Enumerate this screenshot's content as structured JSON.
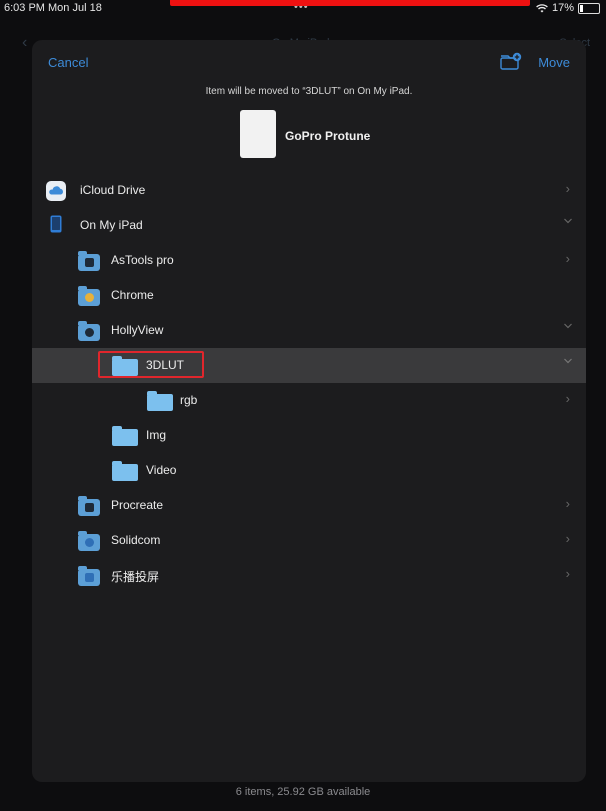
{
  "status_bar": {
    "time_date": "6:03 PM  Mon Jul 18",
    "dots": "•••",
    "battery_text": "17%"
  },
  "background": {
    "back_glyph": "‹",
    "title": "On My iPad",
    "select": "Select"
  },
  "sheet": {
    "cancel_label": "Cancel",
    "move_label": "Move",
    "new_folder_icon": "folder-badge-plus-icon",
    "message": "Item will be moved to “3DLUT” on On My iPad.",
    "document_name": "GoPro Protune"
  },
  "locations": [
    {
      "label": "iCloud Drive",
      "icon": "icloud-icon",
      "chevron": "right"
    },
    {
      "label": "On My iPad",
      "icon": "ipad-icon",
      "chevron": "down"
    },
    {
      "label": "AsTools pro",
      "icon": "app-folder-icon",
      "chevron": "right"
    },
    {
      "label": "Chrome",
      "icon": "app-folder-icon",
      "chevron": ""
    },
    {
      "label": "HollyView",
      "icon": "app-folder-icon",
      "chevron": "down"
    },
    {
      "label": "3DLUT",
      "icon": "folder-icon",
      "chevron": "down",
      "selected": true
    },
    {
      "label": "rgb",
      "icon": "folder-icon",
      "chevron": "right"
    },
    {
      "label": "Img",
      "icon": "folder-icon",
      "chevron": ""
    },
    {
      "label": "Video",
      "icon": "folder-icon",
      "chevron": ""
    },
    {
      "label": "Procreate",
      "icon": "app-folder-icon",
      "chevron": "right"
    },
    {
      "label": "Solidcom",
      "icon": "app-folder-icon",
      "chevron": "right"
    },
    {
      "label": "乐播投屏",
      "icon": "app-folder-icon",
      "chevron": "right"
    }
  ],
  "footer": "6 items, 25.92 GB available",
  "colors": {
    "accent": "#3d8bd8",
    "sheet_bg": "#1c1c1e",
    "selected_row": "#3a3a3c",
    "highlight_box": "#e0262c",
    "folder": "#7cc0ee"
  }
}
